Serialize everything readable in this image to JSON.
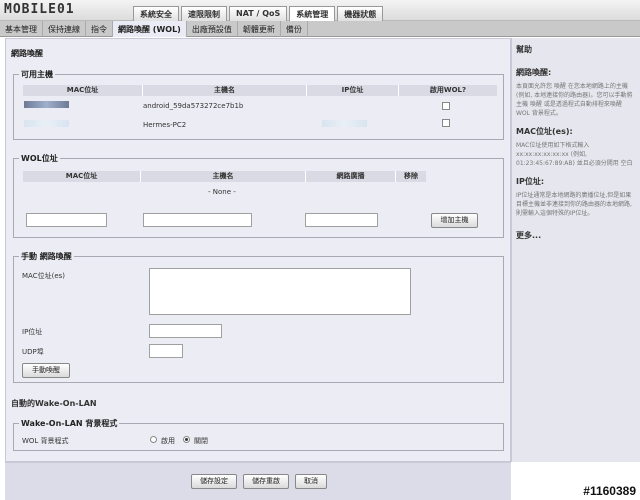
{
  "logo": {
    "text": "MOBILE01"
  },
  "top_tabs": [
    "系統安全",
    "速限限制",
    "NAT / QoS",
    "系統管理",
    "機器狀態"
  ],
  "sub_tabs": [
    "基本管理",
    "保持連線",
    "指令",
    "網路喚醒 (WOL)",
    "出廠預設值",
    "韌體更新",
    "備份"
  ],
  "page": {
    "title": "網路喚醒"
  },
  "available": {
    "title": "可用主機",
    "headers": [
      "MAC位址",
      "主機名",
      "IP位址",
      "啟用WOL?"
    ],
    "rows": [
      {
        "hostname": "android_59da573272ce7b1b"
      },
      {
        "hostname": "Hermes-PC2"
      }
    ]
  },
  "wol": {
    "title": "WOL位址",
    "headers": [
      "MAC位址",
      "主機名",
      "網路廣播",
      "移除"
    ],
    "none_text": "- None -",
    "add_button": "增加主機"
  },
  "manual": {
    "title": "手動 網路喚醒",
    "mac_label": "MAC位址(es)",
    "ip_label": "IP位址",
    "udp_label": "UDP埠",
    "wake_button": "手動喚醒"
  },
  "auto": {
    "title": "自動的Wake-On-LAN",
    "fieldset_title": "Wake-On-LAN 背景程式",
    "daemon_label": "WOL 背景程式",
    "enable_label": "啟用",
    "disable_label": "關閉",
    "selected": "disable"
  },
  "footer": {
    "save": "儲存設定",
    "apply": "儲存重啟",
    "cancel": "取消"
  },
  "help": {
    "title": "幫助",
    "wol_heading": "網路喚醒:",
    "wol_text": "本頁面允許您 喚醒 在您本地網路上的主機 (例如, 本地連接你的路由器)。您可以手動將主機 喚醒 或是透過程式自動排程來喚醒 WOL 背景程式。",
    "mac_heading": "MAC位址(es):",
    "mac_text": "MAC位址使用如下格式輸入 xx:xx:xx:xx:xx:xx (例如, 01:23:45:67:89:AB) 並且必須分開用 空白",
    "ip_heading": "IP位址:",
    "ip_text": "IP位址通常是本地網路的廣播位址,但是如果目標主機並非連接到你的路由器的本地網路,則需輸入這個特殊的IP位址。",
    "more": "更多..."
  },
  "watermark": "#1160389"
}
